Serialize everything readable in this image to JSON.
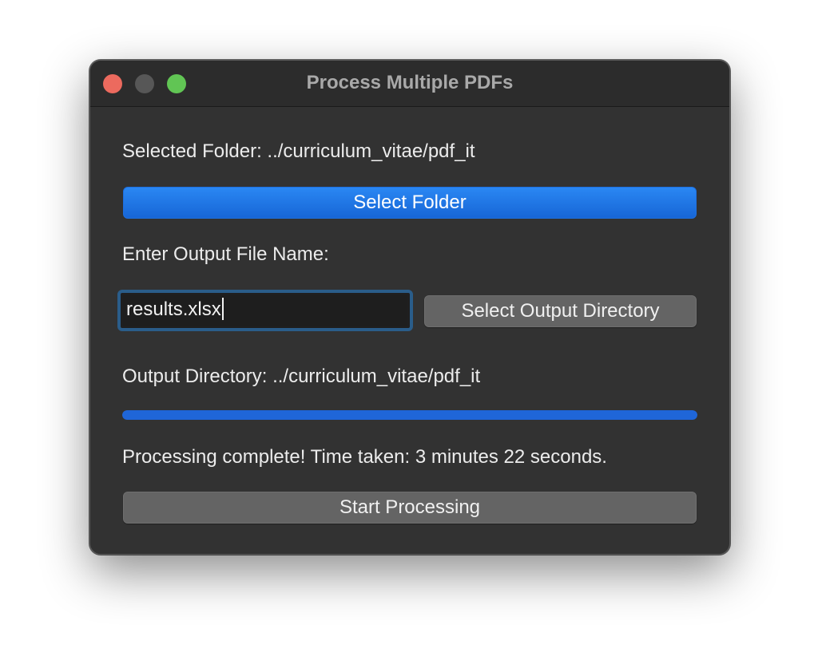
{
  "window": {
    "title": "Process Multiple PDFs"
  },
  "folder": {
    "selected_label": "Selected Folder: ../curriculum_vitae/pdf_it",
    "select_button": "Select Folder"
  },
  "output": {
    "filename_label": "Enter Output File Name:",
    "filename_value": "results.xlsx",
    "select_directory_button": "Select Output Directory",
    "directory_label": "Output Directory: ../curriculum_vitae/pdf_it"
  },
  "progress": {
    "value_percent": 100,
    "fill_color": "#1f66d8"
  },
  "status": {
    "message": "Processing complete! Time taken: 3 minutes 22 seconds."
  },
  "actions": {
    "start_button": "Start Processing"
  },
  "colors": {
    "window_bg": "#323232",
    "primary_button": "#1f72e8",
    "secondary_button": "#646464",
    "focus_ring": "#2a5d8a",
    "close": "#ec6a5e",
    "minimize": "#575757",
    "zoom": "#61c554"
  },
  "icons": {
    "close": "close-dot",
    "minimize": "minimize-dot",
    "zoom": "zoom-dot"
  }
}
